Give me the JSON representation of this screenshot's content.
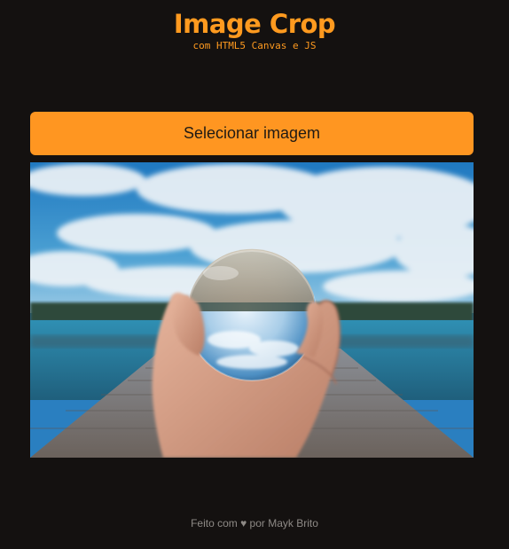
{
  "header": {
    "title": "Image Crop",
    "subtitle": "com HTML5 Canvas e JS"
  },
  "controls": {
    "select_label": "Selecionar imagem"
  },
  "photo": {
    "subject": "hand-holding-crystal-ball-on-pier"
  },
  "footer": {
    "text": "Feito com ♥ por Mayk Brito"
  },
  "colors": {
    "background": "#141110",
    "accent": "#ff9621",
    "footer_text": "#8e8a86"
  }
}
